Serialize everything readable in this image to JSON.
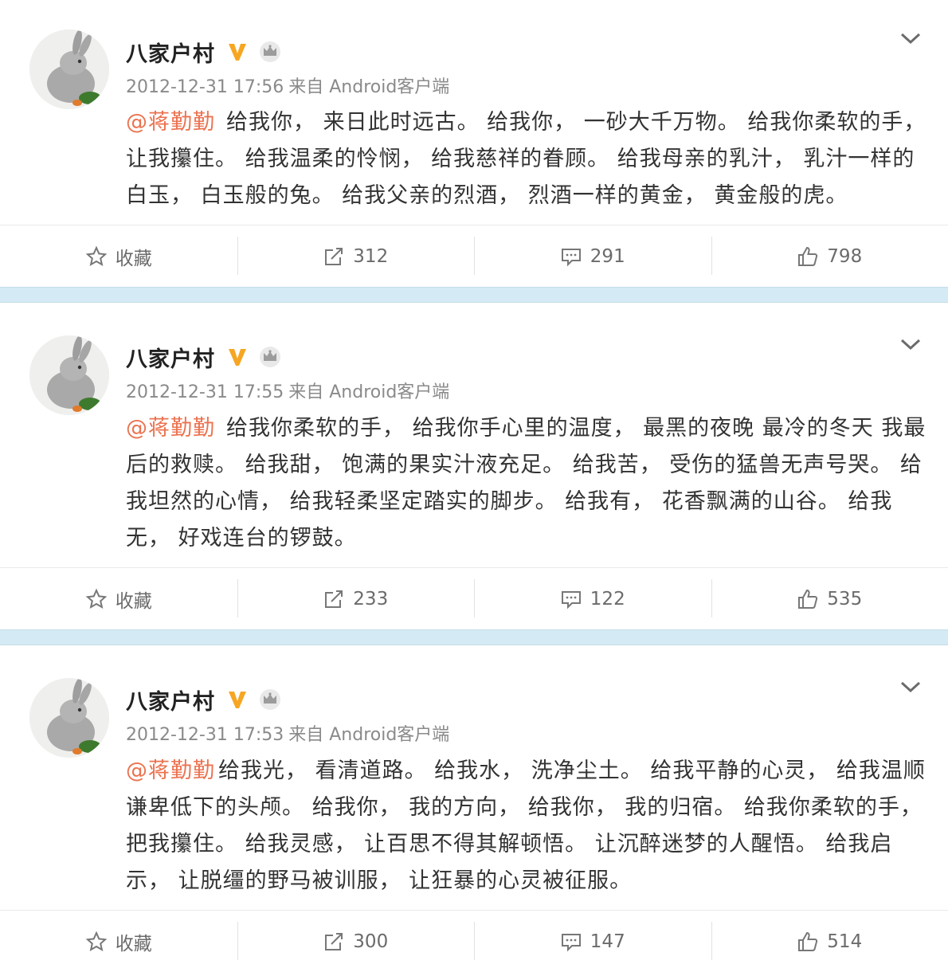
{
  "posts": [
    {
      "author": "八家户村",
      "time": "2012-12-31 17:56",
      "source": "来自 Android客户端",
      "mention": "@蒋勤勤",
      "text": "给我你， 来日此时远古。 给我你， 一砂大千万物。 给我你柔软的手， 让我攥住。 给我温柔的怜悯， 给我慈祥的眷顾。 给我母亲的乳汁， 乳汁一样的白玉， 白玉般的兔。 给我父亲的烈酒， 烈酒一样的黄金， 黄金般的虎。",
      "actions": {
        "favorite": "收藏",
        "repost": "312",
        "comment": "291",
        "like": "798"
      }
    },
    {
      "author": "八家户村",
      "time": "2012-12-31 17:55",
      "source": "来自 Android客户端",
      "mention": "@蒋勤勤",
      "text": "给我你柔软的手， 给我你手心里的温度， 最黑的夜晚 最冷的冬天 我最后的救赎。 给我甜， 饱满的果实汁液充足。 给我苦， 受伤的猛兽无声号哭。 给我坦然的心情， 给我轻柔坚定踏实的脚步。 给我有， 花香飘满的山谷。 给我无， 好戏连台的锣鼓。",
      "actions": {
        "favorite": "收藏",
        "repost": "233",
        "comment": "122",
        "like": "535"
      }
    },
    {
      "author": "八家户村",
      "time": "2012-12-31 17:53",
      "source": "来自 Android客户端",
      "mention": "@蒋勤勤",
      "text": "给我光， 看清道路。 给我水， 洗净尘土。 给我平静的心灵， 给我温顺谦卑低下的头颅。 给我你， 我的方向， 给我你， 我的归宿。 给我你柔软的手， 把我攥住。 给我灵感， 让百思不得其解顿悟。 让沉醉迷梦的人醒悟。 给我启示， 让脱缰的野马被训服， 让狂暴的心灵被征服。",
      "actions": {
        "favorite": "收藏",
        "repost": "300",
        "comment": "147",
        "like": "514"
      }
    }
  ],
  "colors": {
    "mention": "#eb7350",
    "verified": "#f6a623",
    "separator": "#d4eaf4"
  },
  "icons": {
    "verified": "verified-v-icon",
    "crown": "crown-icon",
    "menu": "chevron-down-icon",
    "favorite": "star-icon",
    "repost": "share-icon",
    "comment": "comment-icon",
    "like": "thumbs-up-icon"
  }
}
